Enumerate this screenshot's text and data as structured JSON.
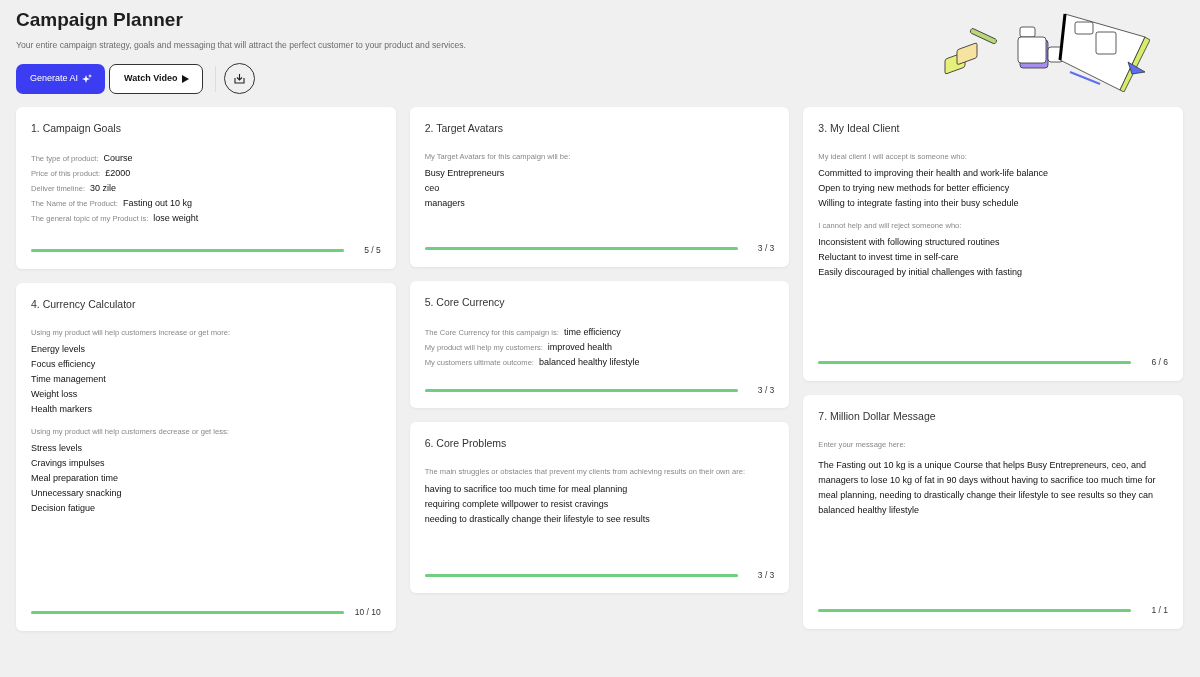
{
  "header": {
    "title": "Campaign Planner",
    "subtitle": "Your entire campaign strategy, goals and messaging that will attract the perfect customer to your product and services."
  },
  "buttons": [
    {
      "kind": "primary",
      "label": "Generate AI"
    },
    {
      "kind": "outline",
      "label": "Watch Video"
    }
  ],
  "columns": [
    {
      "cards": [
        {
          "title": "1. Campaign Goals",
          "sections": [
            {
              "kind": "fields",
              "fields": [
                {
                  "label": "The type of product:",
                  "value": "Course"
                },
                {
                  "label": "Price of this product:",
                  "value": "£2000"
                },
                {
                  "label": "Deliver timeline:",
                  "value": "30 zile"
                },
                {
                  "label": "The Name of the Product:",
                  "value": "Fasting out 10 kg"
                },
                {
                  "label": "The general topic of my Product is:",
                  "value": "lose weight"
                }
              ]
            }
          ],
          "progress": {
            "level": 1,
            "reading": "5 / 5"
          }
        },
        {
          "title": "4. Currency Calculator",
          "sections": [
            {
              "kind": "list",
              "prompt": "Using my product will help customers increase or get more:",
              "items": [
                "Energy levels",
                "Focus efficiency",
                "Time management",
                "Weight loss",
                "Health markers"
              ]
            },
            {
              "kind": "list",
              "prompt": "Using my product will help customers decrease or get less:",
              "items": [
                "Stress levels",
                "Cravings impulses",
                "Meal preparation time",
                "Unnecessary snacking",
                "Decision fatigue"
              ]
            }
          ],
          "progress": {
            "level": 1,
            "reading": "10 / 10"
          }
        }
      ]
    },
    {
      "cards": [
        {
          "title": "2. Target Avatars",
          "sections": [
            {
              "kind": "list",
              "prompt": "My Target Avatars for this campaign will be:",
              "items": [
                "Busy Entrepreneurs",
                "ceo",
                "managers"
              ]
            }
          ],
          "progress": {
            "level": 1,
            "reading": "3 / 3"
          }
        },
        {
          "title": "5. Core Currency",
          "sections": [
            {
              "kind": "fields",
              "fields": [
                {
                  "label": "The Core Currency for this campaign is:",
                  "value": "time efficiency"
                },
                {
                  "label": "My product will help my customers:",
                  "value": "improved health"
                },
                {
                  "label": "My customers ultimate outcome:",
                  "value": "balanced healthy lifestyle"
                }
              ]
            }
          ],
          "progress": {
            "level": 1,
            "reading": "3 / 3"
          }
        },
        {
          "title": "6. Core Problems",
          "sections": [
            {
              "kind": "list",
              "prompt": "The main struggles or obstacles that prevent my clients from achieving results on their own are:",
              "items": [
                "having to sacrifice too much time for meal planning",
                "requiring complete willpower to resist cravings",
                "needing to drastically change their lifestyle to see results"
              ]
            }
          ],
          "progress": {
            "level": 1,
            "reading": "3 / 3"
          }
        }
      ]
    },
    {
      "cards": [
        {
          "title": "3. My Ideal Client",
          "sections": [
            {
              "kind": "list",
              "prompt": "My ideal client I will accept is someone who:",
              "items": [
                "Committed to improving their health and work-life balance",
                "Open to trying new methods for better efficiency",
                "Willing to integrate fasting into their busy schedule"
              ]
            },
            {
              "kind": "list",
              "prompt": "I cannot help and will reject someone who:",
              "items": [
                "Inconsistent with following structured routines",
                "Reluctant to invest time in self-care",
                "Easily discouraged by initial challenges with fasting"
              ]
            }
          ],
          "progress": {
            "level": 1,
            "reading": "6 / 6"
          }
        },
        {
          "title": "7. Million Dollar Message",
          "sections": [
            {
              "kind": "paragraph",
              "prompt": "Enter your message here:",
              "text": "The Fasting out 10 kg is a unique Course that helps Busy Entrepreneurs, ceo, and managers to lose 10 kg of fat in 90 days without having to sacrifice too much time for meal planning, needing to drastically change their lifestyle to see results so they can balanced healthy lifestyle"
            }
          ],
          "progress": {
            "level": 1,
            "reading": "1 / 1"
          }
        }
      ]
    }
  ]
}
